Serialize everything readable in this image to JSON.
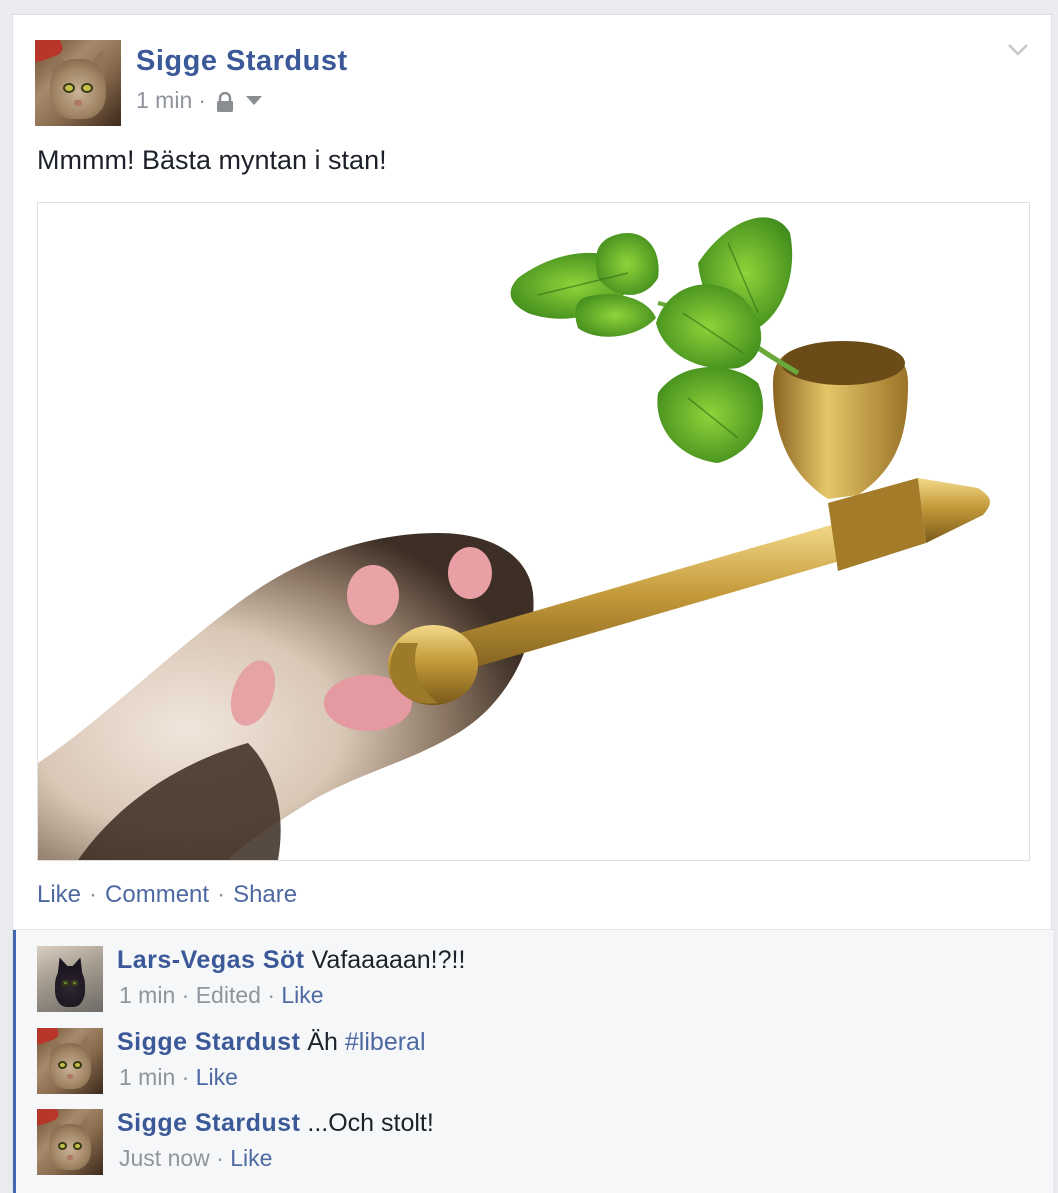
{
  "post": {
    "author": "Sigge Stardust",
    "time": "1 min",
    "separator": "·",
    "privacy_icon": "lock-icon",
    "audience_icon": "caret-down-icon",
    "options_icon": "chevron-down-icon",
    "text": "Mmmm! Bästa myntan i stan!",
    "photo_icon": "cat-paw-pipe-photo"
  },
  "actions": {
    "like": "Like",
    "comment": "Comment",
    "share": "Share",
    "separator": "·"
  },
  "comments": [
    {
      "author": "Lars-Vegas Söt",
      "text": "Vafaaaaan!?!!",
      "hashtag": "",
      "time": "1 min",
      "edited": "Edited",
      "like": "Like"
    },
    {
      "author": "Sigge Stardust",
      "text": "Äh ",
      "hashtag": "#liberal",
      "time": "1 min",
      "like": "Like"
    },
    {
      "author": "Sigge Stardust",
      "text": "...Och stolt!",
      "hashtag": "",
      "time": "Just now",
      "like": "Like"
    }
  ],
  "colors": {
    "name": "#3b5998",
    "link": "#4e69a2",
    "meta": "#90949c",
    "accent_bar": "#4267b2"
  }
}
